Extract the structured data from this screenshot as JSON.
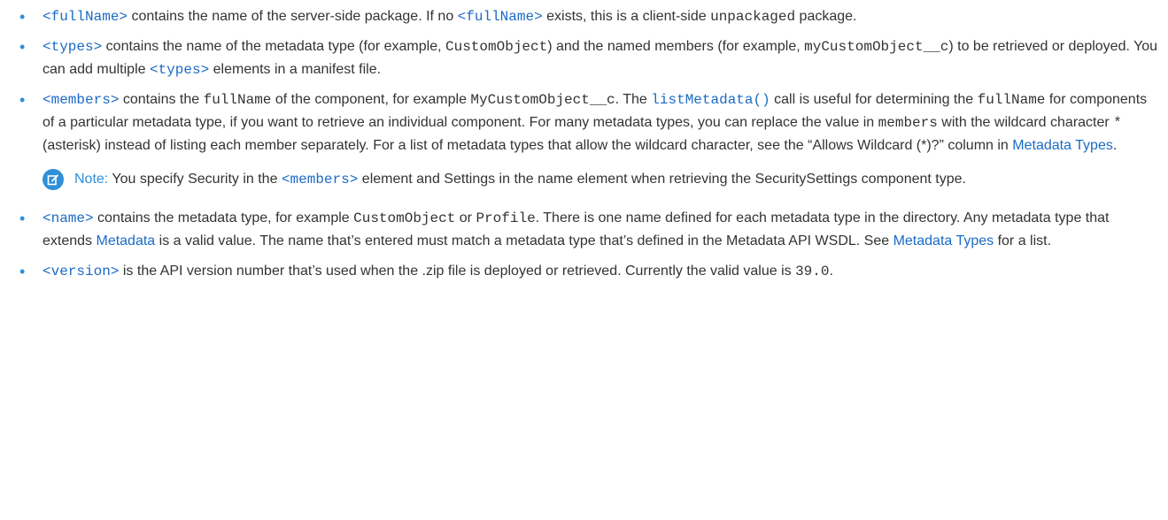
{
  "colors": {
    "bullet": "#2f8fd8",
    "link": "#1a6bc4",
    "note_accent": "#2f8fd8",
    "text": "#333333"
  },
  "items": {
    "fullname": {
      "tag": "<fullName>",
      "t1": " contains the name of the server-side package. If no ",
      "tag2": "<fullName>",
      "t2": " exists, this is a client-side ",
      "code1": "unpackaged",
      "t3": " package."
    },
    "types": {
      "tag": "<types>",
      "t1": " contains the name of the metadata type (for example, ",
      "code1": "CustomObject",
      "t2": ") and the named members (for example, ",
      "code2": "myCustomObject__c",
      "t3": ") to be retrieved or deployed. You can add multiple ",
      "tag2": "<types>",
      "t4": " elements in a manifest file."
    },
    "members": {
      "tag": "<members>",
      "t1": " contains the ",
      "code1": "fullName",
      "t2": " of the component, for example ",
      "code2": "MyCustomObject__c",
      "t3": ". The ",
      "link1": "listMetadata()",
      "t4": " call is useful for determining the ",
      "code3": "fullName",
      "t5": " for components of a particular metadata type, if you want to retrieve an individual component. For many metadata types, you can replace the value in ",
      "code4": "members",
      "t6": " with the wildcard character ",
      "code5": "*",
      "t7": " (asterisk) instead of listing each member separately. For a list of metadata types that allow the wildcard character, see the “Allows Wildcard (*)?” column in ",
      "link2": "Metadata Types",
      "t8": "."
    },
    "note": {
      "icon": "edit-note-icon",
      "label": "Note:",
      "t1": " You specify Security in the ",
      "tag": "<members>",
      "t2": " element and Settings in the name element when retrieving the SecuritySettings component type."
    },
    "name": {
      "tag": "<name>",
      "t1": " contains the metadata type, for example ",
      "code1": "CustomObject",
      "t2": " or ",
      "code2": "Profile",
      "t3": ". There is one name defined for each metadata type in the directory. Any metadata type that extends ",
      "link1": "Metadata",
      "t4": " is a valid value. The name that’s entered must match a metadata type that’s defined in the Metadata API WSDL. See ",
      "link2": "Metadata Types",
      "t5": " for a list."
    },
    "version": {
      "tag": "<version>",
      "t1": " is the API version number that’s used when the .zip file is deployed or retrieved. Currently the valid value is ",
      "code1": "39.0",
      "t2": "."
    }
  }
}
